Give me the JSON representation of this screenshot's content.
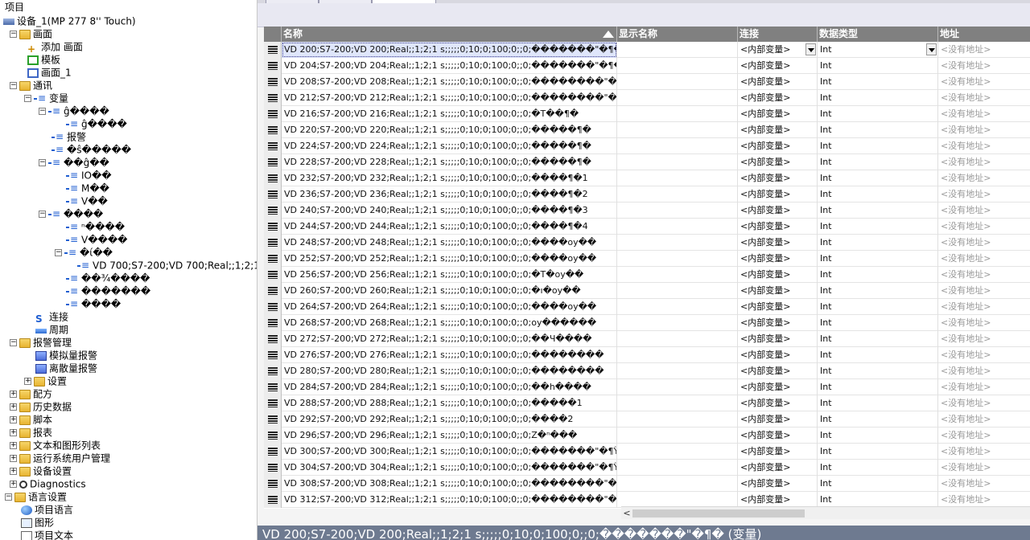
{
  "tree": {
    "header": "项目",
    "items": [
      {
        "label": "设备_1(MP 277 8'' Touch)",
        "icon": "device-icon",
        "tw": ""
      },
      {
        "label": "画面",
        "icon": "folder-icon",
        "tw": "−"
      },
      {
        "label": "添加 画面",
        "icon": "add-screen-icon",
        "tw": ""
      },
      {
        "label": "模板",
        "icon": "template-icon",
        "tw": ""
      },
      {
        "label": "画面_1",
        "icon": "screen-icon",
        "tw": ""
      },
      {
        "label": "通讯",
        "icon": "folder-icon",
        "tw": "−"
      },
      {
        "label": "变量",
        "icon": "variable-icon",
        "tw": "−"
      },
      {
        "label": "ĝ����",
        "icon": "variable-icon",
        "tw": "−"
      },
      {
        "label": "ĝ����",
        "icon": "variable-icon",
        "tw": ""
      },
      {
        "label": "报警",
        "icon": "variable-icon",
        "tw": ""
      },
      {
        "label": "�ŝ�����",
        "icon": "variable-icon",
        "tw": ""
      },
      {
        "label": "��ĝ��",
        "icon": "variable-icon",
        "tw": "−"
      },
      {
        "label": "IO��",
        "icon": "variable-icon",
        "tw": ""
      },
      {
        "label": "M��",
        "icon": "variable-icon",
        "tw": ""
      },
      {
        "label": "V��",
        "icon": "variable-icon",
        "tw": ""
      },
      {
        "label": "����",
        "icon": "variable-icon",
        "tw": "−"
      },
      {
        "label": "ⁿ����",
        "icon": "variable-icon",
        "tw": ""
      },
      {
        "label": "V����",
        "icon": "variable-icon",
        "tw": ""
      },
      {
        "label": "�ί��",
        "icon": "variable-icon",
        "tw": "−"
      },
      {
        "label": "VD 700;S7-200;VD 700;Real;;1;2;1",
        "icon": "variable-icon",
        "tw": ""
      },
      {
        "label": "��¾����",
        "icon": "variable-icon",
        "tw": ""
      },
      {
        "label": "�������",
        "icon": "variable-icon",
        "tw": ""
      },
      {
        "label": "����",
        "icon": "variable-icon",
        "tw": ""
      },
      {
        "label": "连接",
        "icon": "connection-icon",
        "tw": ""
      },
      {
        "label": "周期",
        "icon": "cycle-icon",
        "tw": ""
      },
      {
        "label": "报警管理",
        "icon": "folder-icon",
        "tw": "−"
      },
      {
        "label": "模拟量报警",
        "icon": "analog-alarm-icon",
        "tw": ""
      },
      {
        "label": "离散量报警",
        "icon": "discrete-alarm-icon",
        "tw": ""
      },
      {
        "label": "设置",
        "icon": "folder-icon",
        "tw": "+"
      },
      {
        "label": "配方",
        "icon": "folder-icon",
        "tw": "+"
      },
      {
        "label": "历史数据",
        "icon": "folder-icon",
        "tw": "+"
      },
      {
        "label": "脚本",
        "icon": "folder-icon",
        "tw": "+"
      },
      {
        "label": "报表",
        "icon": "folder-icon",
        "tw": "+"
      },
      {
        "label": "文本和图形列表",
        "icon": "folder-icon",
        "tw": "+"
      },
      {
        "label": "运行系统用户管理",
        "icon": "folder-icon",
        "tw": "+"
      },
      {
        "label": "设备设置",
        "icon": "folder-icon",
        "tw": "+"
      },
      {
        "label": "Diagnostics",
        "icon": "diagnostics-icon",
        "tw": "+"
      },
      {
        "label": "语言设置",
        "icon": "folder-icon",
        "tw": "−"
      },
      {
        "label": "项目语言",
        "icon": "globe-icon",
        "tw": ""
      },
      {
        "label": "图形",
        "icon": "image-icon",
        "tw": ""
      },
      {
        "label": "项目文本",
        "icon": "document-icon",
        "tw": ""
      }
    ]
  },
  "grid": {
    "columns": {
      "name": "名称",
      "display_name": "显示名称",
      "connection": "连接",
      "data_type": "数据类型",
      "address": "地址"
    },
    "rows": [
      {
        "name": "VD 200;S7-200;VD 200;Real;;1;2;1 s;;;;;0;10;0;100;0;;0;�������\"�¶�",
        "display": "",
        "connection": "<内部变量>",
        "type": "Int",
        "address": "<没有地址>"
      },
      {
        "name": "VD 204;S7-200;VD 204;Real;;1;2;1 s;;;;;0;10;0;100;0;;0;�������\"�¶�",
        "display": "",
        "connection": "<内部变量>",
        "type": "Int",
        "address": "<没有地址>"
      },
      {
        "name": "VD 208;S7-200;VD 208;Real;;1;2;1 s;;;;;0;10;0;100;0;;0;��������\"�¶�",
        "display": "",
        "connection": "<内部变量>",
        "type": "Int",
        "address": "<没有地址>"
      },
      {
        "name": "VD 212;S7-200;VD 212;Real;;1;2;1 s;;;;;0;10;0;100;0;;0;��������\"�¶�",
        "display": "",
        "connection": "<内部变量>",
        "type": "Int",
        "address": "<没有地址>"
      },
      {
        "name": "VD 216;S7-200;VD 216;Real;;1;2;1 s;;;;;0;10;0;100;0;;0;�T��¶�",
        "display": "",
        "connection": "<内部变量>",
        "type": "Int",
        "address": "<没有地址>"
      },
      {
        "name": "VD 220;S7-200;VD 220;Real;;1;2;1 s;;;;;0;10;0;100;0;;0;�����¶�",
        "display": "",
        "connection": "<内部变量>",
        "type": "Int",
        "address": "<没有地址>"
      },
      {
        "name": "VD 224;S7-200;VD 224;Real;;1;2;1 s;;;;;0;10;0;100;0;;0;�����¶�",
        "display": "",
        "connection": "<内部变量>",
        "type": "Int",
        "address": "<没有地址>"
      },
      {
        "name": "VD 228;S7-200;VD 228;Real;;1;2;1 s;;;;;0;10;0;100;0;;0;�����¶�",
        "display": "",
        "connection": "<内部变量>",
        "type": "Int",
        "address": "<没有地址>"
      },
      {
        "name": "VD 232;S7-200;VD 232;Real;;1;2;1 s;;;;;0;10;0;100;0;;0;����¶�1",
        "display": "",
        "connection": "<内部变量>",
        "type": "Int",
        "address": "<没有地址>"
      },
      {
        "name": "VD 236;S7-200;VD 236;Real;;1;2;1 s;;;;;0;10;0;100;0;;0;����¶�2",
        "display": "",
        "connection": "<内部变量>",
        "type": "Int",
        "address": "<没有地址>"
      },
      {
        "name": "VD 240;S7-200;VD 240;Real;;1;2;1 s;;;;;0;10;0;100;0;;0;����¶�3",
        "display": "",
        "connection": "<内部变量>",
        "type": "Int",
        "address": "<没有地址>"
      },
      {
        "name": "VD 244;S7-200;VD 244;Real;;1;2;1 s;;;;;0;10;0;100;0;;0;����¶�4",
        "display": "",
        "connection": "<内部变量>",
        "type": "Int",
        "address": "<没有地址>"
      },
      {
        "name": "VD 248;S7-200;VD 248;Real;;1;2;1 s;;;;;0;10;0;100;0;;0;����oy��",
        "display": "",
        "connection": "<内部变量>",
        "type": "Int",
        "address": "<没有地址>"
      },
      {
        "name": "VD 252;S7-200;VD 252;Real;;1;2;1 s;;;;;0;10;0;100;0;;0;����oy��",
        "display": "",
        "connection": "<内部变量>",
        "type": "Int",
        "address": "<没有地址>"
      },
      {
        "name": "VD 256;S7-200;VD 256;Real;;1;2;1 s;;;;;0;10;0;100;0;;0;�T�oy��",
        "display": "",
        "connection": "<内部变量>",
        "type": "Int",
        "address": "<没有地址>"
      },
      {
        "name": "VD 260;S7-200;VD 260;Real;;1;2;1 s;;;;;0;10;0;100;0;;0;�ı�oy��",
        "display": "",
        "connection": "<内部变量>",
        "type": "Int",
        "address": "<没有地址>"
      },
      {
        "name": "VD 264;S7-200;VD 264;Real;;1;2;1 s;;;;;0;10;0;100;0;;0;����oy��",
        "display": "",
        "connection": "<内部变量>",
        "type": "Int",
        "address": "<没有地址>"
      },
      {
        "name": "VD 268;S7-200;VD 268;Real;;1;2;1 s;;;;;0;10;0;100;0;;0;oy������",
        "display": "",
        "connection": "<内部变量>",
        "type": "Int",
        "address": "<没有地址>"
      },
      {
        "name": "VD 272;S7-200;VD 272;Real;;1;2;1 s;;;;;0;10;0;100;0;;0;��Ч����",
        "display": "",
        "connection": "<内部变量>",
        "type": "Int",
        "address": "<没有地址>"
      },
      {
        "name": "VD 276;S7-200;VD 276;Real;;1;2;1 s;;;;;0;10;0;100;0;;0;��������",
        "display": "",
        "connection": "<内部变量>",
        "type": "Int",
        "address": "<没有地址>"
      },
      {
        "name": "VD 280;S7-200;VD 280;Real;;1;2;1 s;;;;;0;10;0;100;0;;0;��������",
        "display": "",
        "connection": "<内部变量>",
        "type": "Int",
        "address": "<没有地址>"
      },
      {
        "name": "VD 284;S7-200;VD 284;Real;;1;2;1 s;;;;;0;10;0;100;0;;0;��h����",
        "display": "",
        "connection": "<内部变量>",
        "type": "Int",
        "address": "<没有地址>"
      },
      {
        "name": "VD 288;S7-200;VD 288;Real;;1;2;1 s;;;;;0;10;0;100;0;;0;�����1",
        "display": "",
        "connection": "<内部变量>",
        "type": "Int",
        "address": "<没有地址>"
      },
      {
        "name": "VD 292;S7-200;VD 292;Real;;1;2;1 s;;;;;0;10;0;100;0;;0;����2",
        "display": "",
        "connection": "<内部变量>",
        "type": "Int",
        "address": "<没有地址>"
      },
      {
        "name": "VD 296;S7-200;VD 296;Real;;1;2;1 s;;;;;0;10;0;100;0;;0;Z�ⁿ���",
        "display": "",
        "connection": "<内部变量>",
        "type": "Int",
        "address": "<没有地址>"
      },
      {
        "name": "VD 300;S7-200;VD 300;Real;;1;2;1 s;;;;;0;10;0;100;0;;0;�������\"�¶Ÿ...",
        "display": "",
        "connection": "<内部变量>",
        "type": "Int",
        "address": "<没有地址>"
      },
      {
        "name": "VD 304;S7-200;VD 304;Real;;1;2;1 s;;;;;0;10;0;100;0;;0;�������\"�¶Ÿ...",
        "display": "",
        "connection": "<内部变量>",
        "type": "Int",
        "address": "<没有地址>"
      },
      {
        "name": "VD 308;S7-200;VD 308;Real;;1;2;1 s;;;;;0;10;0;100;0;;0;��������\"�¶...",
        "display": "",
        "connection": "<内部变量>",
        "type": "Int",
        "address": "<没有地址>"
      },
      {
        "name": "VD 312;S7-200;VD 312;Real;;1;2;1 s;;;;;0;10;0;100;0;;0;��������\"�¶...",
        "display": "",
        "connection": "<内部变量>",
        "type": "Int",
        "address": "<没有地址>"
      }
    ]
  },
  "statusbar": {
    "text": "VD 200;S7-200;VD 200;Real;;1;2;1 s;;;;;0;10;0;100;0;;0;�������\"�¶� (变量)"
  },
  "colors": {
    "header_bg": "#808080",
    "selected_row": "#dfe6fb",
    "statusbar_bg": "#6e7a90",
    "address_text": "#9a9a9a"
  }
}
